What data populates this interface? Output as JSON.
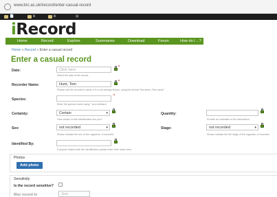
{
  "browser": {
    "url": "www.brc.ac.uk/irecord/enter-casual-record",
    "bookmarks": [
      "📄",
      "Ⅲ",
      "Ⅲ",
      "⊞"
    ]
  },
  "logo": {
    "text_i": "i",
    "text_rest": "Record"
  },
  "nav": [
    "Home",
    "Record",
    "Explore",
    "Summaries",
    "Download",
    "Forum",
    "How do I ...?"
  ],
  "breadcrumb": {
    "home": "Home",
    "sep1": " » ",
    "record": "Record",
    "sep2": " » ",
    "current": "Enter a casual record"
  },
  "page_title": "Enter a casual record",
  "form": {
    "date": {
      "label": "Date:",
      "placeholder": "Click here",
      "help": "Select the date of the record."
    },
    "recorder": {
      "label": "Recorder Name:",
      "value": "Hunt, Tom",
      "help": "Please edit the recorder's name, if it is not already shown, using the format \"Surname, First name\""
    },
    "species": {
      "label": "Species:",
      "value": "",
      "help": "Enter the species name using \" as a wildcard"
    },
    "certainty": {
      "label": "Certainty:",
      "value": "Certain",
      "help": "How certain of this identification are you?"
    },
    "quantity": {
      "label": "Quantity:",
      "value": "",
      "help": "Provide an indication of the abundance"
    },
    "sex": {
      "label": "Sex:",
      "value": "not recorded",
      "help": "Please indicate the sex of the organism, if recorded."
    },
    "stage": {
      "label": "Stage:",
      "value": "not recorded",
      "help": "Please indicate the life stage of the organism, if recorded."
    },
    "identified_by": {
      "label": "Identified By:",
      "value": "",
      "help": "If anyone helped with the identification please enter their name here."
    },
    "required_star": "*"
  },
  "photos": {
    "heading": "Photos",
    "button": "Add photo"
  },
  "sensitivity": {
    "heading": "Sensitivity",
    "question": "Is the record sensitive?",
    "blur_label": "Blur record to",
    "blur_value": "1km"
  }
}
